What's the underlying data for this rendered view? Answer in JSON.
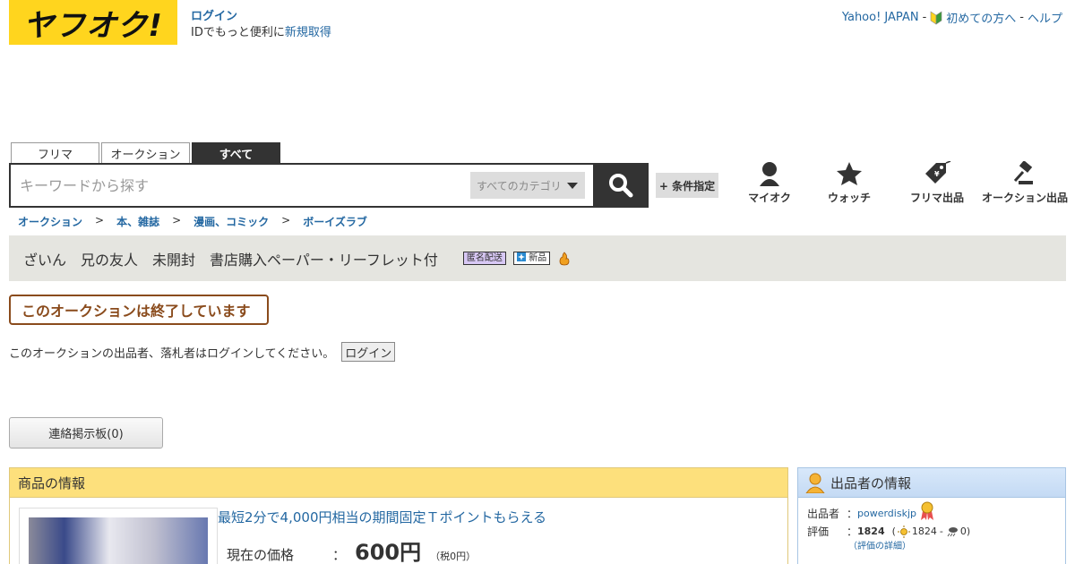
{
  "header": {
    "logo_text": "ヤフオク!",
    "login_label": "ログイン",
    "login_sub_text": "IDでもっと便利に",
    "register_link": "新規取得",
    "links": [
      "Yahoo! JAPAN",
      "初めての方へ",
      "ヘルプ"
    ]
  },
  "search": {
    "tabs": [
      "フリマ",
      "オークション",
      "すべて"
    ],
    "active_tab": "すべて",
    "placeholder": "キーワードから探す",
    "category": "すべてのカテゴリ",
    "condition_button": "+ 条件指定"
  },
  "nav": {
    "items": [
      "マイオク",
      "ウォッチ",
      "フリマ出品",
      "オークション出品"
    ]
  },
  "breadcrumb": [
    "オークション",
    "本、雑誌",
    "漫画、コミック",
    "ボーイズラブ"
  ],
  "item": {
    "title": "ざいん　兄の友人　未開封　書店購入ペーパー・リーフレット付",
    "badge_anonymous": "匿名配送",
    "badge_new": "新品",
    "ended_message": "このオークションは終了しています",
    "login_prompt": "このオークションの出品者、落札者はログインしてください。",
    "login_button": "ログイン",
    "board_button": "連絡掲示板(0)"
  },
  "item_panel": {
    "heading": "商品の情報",
    "promo": "最短2分で4,000円相当の期間固定Ｔポイントもらえる",
    "price_label": "現在の価格",
    "price": "600円",
    "tax": "（税0円）"
  },
  "seller": {
    "heading": "出品者の情報",
    "seller_label": "出品者",
    "seller_name": "powerdiskjp",
    "rating_label": "評価",
    "rating_total": "1824",
    "rating_good": "1824",
    "rating_bad": "0",
    "rating_detail": "（評価の詳細）"
  },
  "colors": {
    "brand_yellow": "#ffd51e",
    "link_blue": "#2468a2",
    "ended_brown": "#8a4b1c",
    "panel_yellow": "#fde07c",
    "panel_blue": "#c4daf4"
  }
}
